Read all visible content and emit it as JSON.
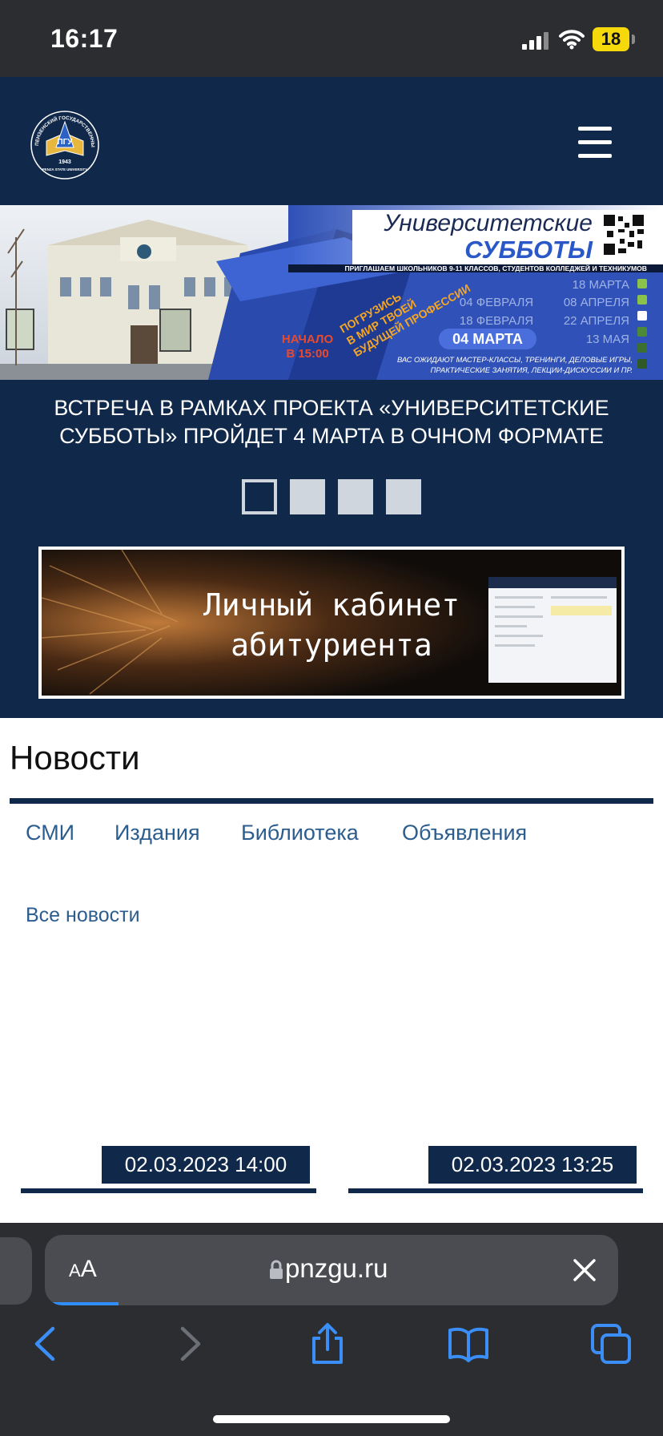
{
  "status_bar": {
    "time": "16:17",
    "battery": "18"
  },
  "header": {
    "logo_texts": [
      "ПЕНЗЕНСКИЙ ГОСУДАРСТВЕННЫЙ УНИВЕРСИТЕТ",
      "ПГУ",
      "1943",
      "PENZA STATE UNIVERSITY"
    ]
  },
  "banner": {
    "title_line1": "Университетские",
    "title_line2": "СУББОТЫ",
    "invite": "ПРИГЛАШАЕМ ШКОЛЬНИКОВ 9-11 КЛАССОВ, СТУДЕНТОВ КОЛЛЕДЖЕЙ И ТЕХНИКУМОВ",
    "slogan": [
      "ПОГРУЗИСЬ",
      "В МИР ТВОЕЙ",
      "БУДУЩЕЙ ПРОФЕССИИ"
    ],
    "start": [
      "НАЧАЛО",
      "В 15:00"
    ],
    "dates_left": [
      "04 ФЕВРАЛЯ",
      "18 ФЕВРАЛЯ"
    ],
    "dates_right": [
      "18 МАРТА",
      "08 АПРЕЛЯ",
      "22 АПРЕЛЯ",
      "13 МАЯ"
    ],
    "highlight_date": "04 МАРТА",
    "footer_line1": "ВАС ОЖИДАЮТ МАСТЕР-КЛАССЫ, ТРЕНИНГИ, ДЕЛОВЫЕ ИГРЫ,",
    "footer_line2": "ПРАКТИЧЕСКИЕ ЗАНЯТИЯ, ЛЕКЦИИ-ДИСКУССИИ И ПР."
  },
  "slider": {
    "caption": "ВСТРЕЧА В РАМКАХ ПРОЕКТА «УНИВЕРСИТЕТСКИЕ СУББОТЫ» ПРОЙДЕТ 4 МАРТА В ОЧНОМ ФОРМАТЕ",
    "active_index": 0
  },
  "cabinet_banner": {
    "line1": "Личный кабинет",
    "line2": "абитуриента"
  },
  "news": {
    "title": "Новости",
    "tabs": [
      "СМИ",
      "Издания",
      "Библиотека",
      "Объявления"
    ],
    "all_news": "Все новости",
    "items": [
      {
        "date": "02.03.2023 14:00"
      },
      {
        "date": "02.03.2023 13:25"
      }
    ]
  },
  "browser": {
    "text_size_label": {
      "small": "A",
      "large": "A"
    },
    "url": "pnzgu.ru"
  },
  "icons": {
    "signal": "signal-icon",
    "wifi": "wifi-icon",
    "battery": "battery-icon",
    "menu": "hamburger-menu-icon",
    "lock": "lock-icon",
    "close": "close-icon",
    "back": "back-arrow-icon",
    "forward": "forward-arrow-icon",
    "share": "share-icon",
    "bookmarks": "bookmarks-icon",
    "tabs": "tabs-icon"
  },
  "colors": {
    "navy": "#10294a",
    "link": "#2c5d8f",
    "safari_accent": "#2f8ef7",
    "banner_blue": "#2f51b8"
  }
}
